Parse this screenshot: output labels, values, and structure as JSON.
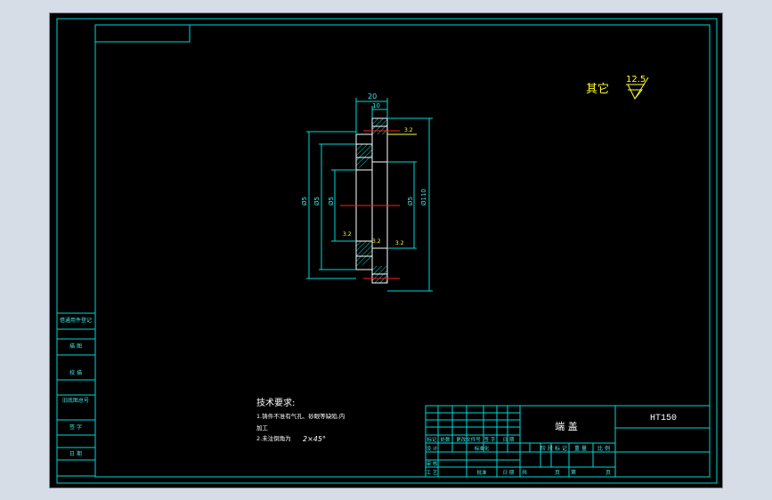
{
  "drawing": {
    "surface_roughness": {
      "label": "其它",
      "value": "12.5"
    },
    "dimensions": {
      "width_top": "20",
      "width_inner": "10",
      "dia_left_1": "Ø5",
      "dia_left_2": "Ø5",
      "dia_left_3": "Ø5",
      "dia_right": "Ø110",
      "roughness_top": "3.2",
      "roughness_left": "3.2",
      "roughness_mid": "3.2"
    },
    "tech_requirements": {
      "title": "技术要求:",
      "line1": "1.铸件不准有气孔、砂眼等缺陷,内",
      "line2": "加工",
      "line3": "2.未注倒角为",
      "chamfer": "2×45°"
    },
    "left_table": {
      "rows": [
        "借通用件登记",
        "描 图",
        "校 描",
        "旧底图总号",
        "签 字",
        "日 期"
      ]
    },
    "title_block": {
      "part_name": "端 盖",
      "material": "HT150",
      "row_marks": [
        "标记",
        "处数",
        "更改文件号",
        "签 字",
        "日 期"
      ],
      "design_rows": [
        "设 计",
        "审 核",
        "工 艺"
      ],
      "standardization": "标准化",
      "approve": "批准",
      "stage_headers": [
        "阶 段 标 记",
        "重 量",
        "比 例"
      ],
      "sheet_total": "共",
      "sheet_unit": "页",
      "sheet_no": "第",
      "sheet_unit2": "页",
      "date_label": "日 期"
    },
    "colors": {
      "background": "#000000",
      "frame": "#00d8d8",
      "part_outline": "#ffffff",
      "center_line": "#ff2020",
      "annotation": "#ffff30"
    }
  }
}
